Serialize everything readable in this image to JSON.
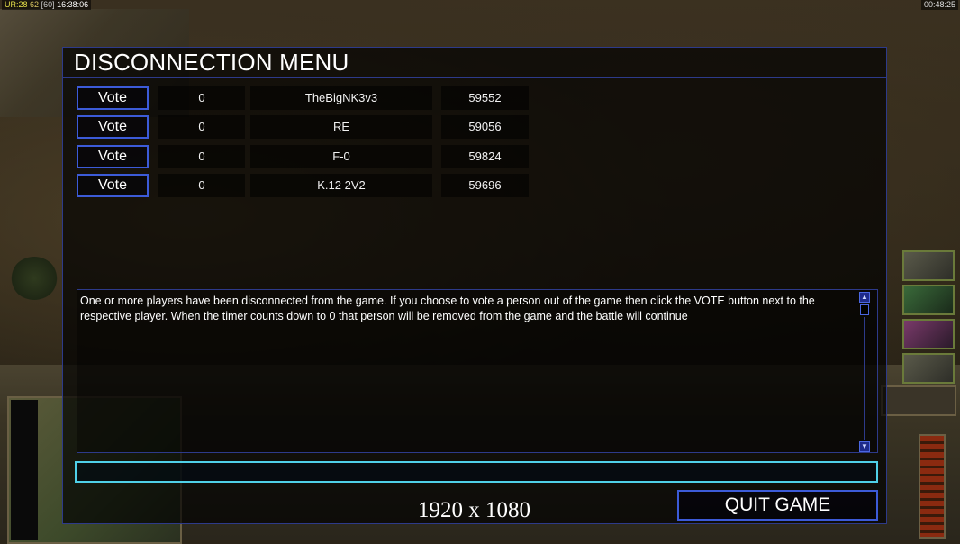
{
  "hud": {
    "fps_label": "UR:",
    "fps_values": [
      "28",
      "62"
    ],
    "fps_cap": "60",
    "clock": "16:38:06",
    "game_time": "00:48:25"
  },
  "dialog": {
    "title": "DISCONNECTION MENU",
    "vote_label": "Vote",
    "players": [
      {
        "votes": "0",
        "name": "TheBigNK3v3",
        "ping": "59552"
      },
      {
        "votes": "0",
        "name": "RE",
        "ping": "59056"
      },
      {
        "votes": "0",
        "name": "F-0",
        "ping": "59824"
      },
      {
        "votes": "0",
        "name": "K.12 2V2",
        "ping": "59696"
      }
    ],
    "message": "One or more players have been disconnected from the game. If you choose to vote a person out of the game then click the VOTE button next to the respective player. When the timer counts down to 0 that person will be removed from the game and the battle will continue",
    "chat_value": "",
    "resolution": "1920 x 1080",
    "quit_label": "QUIT GAME"
  },
  "colors": {
    "accent_border": "#3c5bd8",
    "chat_border": "#4fd0e8",
    "panel_bg": "rgba(0,0,0,0.68)"
  }
}
